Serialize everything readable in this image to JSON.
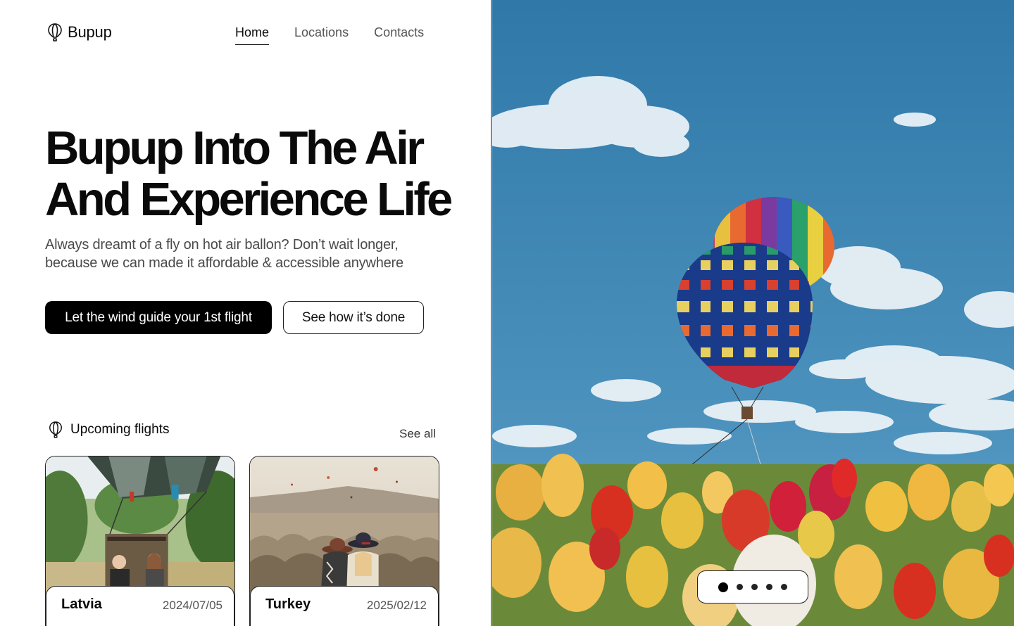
{
  "brand": {
    "name": "Bupup",
    "icon": "balloon-icon"
  },
  "nav": [
    {
      "label": "Home",
      "active": true
    },
    {
      "label": "Locations",
      "active": false
    },
    {
      "label": "Contacts",
      "active": false
    }
  ],
  "hero": {
    "title_line1": "Bupup Into The Air",
    "title_line2": "And Experience Life",
    "subtitle_line1": "Always dreamt of a fly on hot air ballon? Don’t wait longer,",
    "subtitle_line2": "because we can made it affordable & accessible anywhere",
    "primary_cta": "Let the wind guide your 1st flight",
    "secondary_cta": "See how it’s done"
  },
  "upcoming": {
    "title": "Upcoming flights",
    "see_all": "See all",
    "flights": [
      {
        "location": "Latvia",
        "date": "2024/07/05"
      },
      {
        "location": "Turkey",
        "date": "2025/02/12"
      }
    ]
  },
  "carousel": {
    "slides": 5,
    "active_index": 0
  },
  "colors": {
    "primary": "#000000",
    "text": "#0a0a0a",
    "muted": "#4a4a4a",
    "sky": "#3b7ea8"
  }
}
